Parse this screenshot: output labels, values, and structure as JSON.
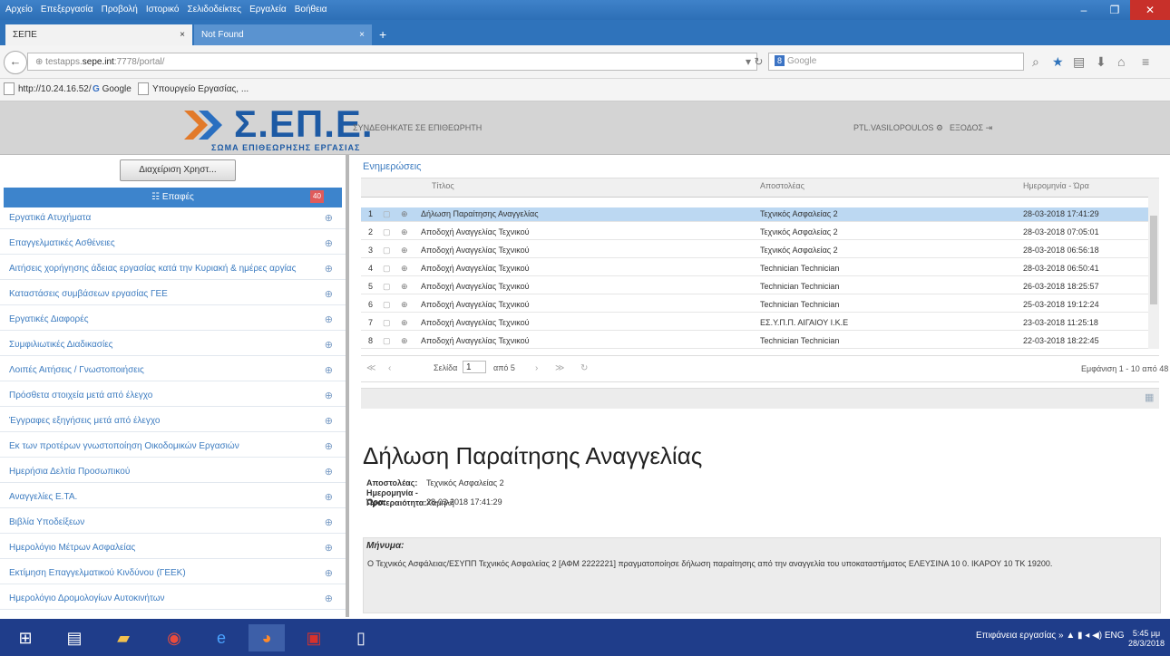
{
  "browser": {
    "menu": [
      "Αρχείο",
      "Επεξεργασία",
      "Προβολή",
      "Ιστορικό",
      "Σελιδοδείκτες",
      "Εργαλεία",
      "Βοήθεια"
    ],
    "window_controls": [
      "–",
      "❐",
      "✕"
    ],
    "tabs": [
      {
        "title": "ΣΕΠΕ",
        "close": "×"
      },
      {
        "title": "Not Found",
        "close": "×"
      }
    ],
    "new_tab": "+",
    "url_prefix": "testapps.",
    "url_host": "sepe.int",
    "url_rest": ":7778/portal/",
    "search_engine": "8",
    "search_placeholder": "Google",
    "bookmarks": [
      "http://10.24.16.52/",
      "Google",
      "Υπουργείο Εργασίας, ..."
    ]
  },
  "app": {
    "logo": "Σ.ΕΠ.Ε.",
    "logo_sub": "ΣΩΜΑ ΕΠΙΘΕΩΡΗΣΗΣ ΕΡΓΑΣΙΑΣ",
    "header_title": "ΣΥΝΔΕΘΗΚΑΤΕ ΣΕ ΕΠΙΘΕΩΡΗΤΗ",
    "user": "PTL.VASILOPOULOS",
    "logout": "ΕΞΟΔΟΣ"
  },
  "sidebar": {
    "select_button": "Διαχείριση Χρηστ...",
    "header": "Επαφές",
    "badge": "40",
    "items": [
      "Εργατικά Ατυχήματα",
      "Επαγγελματικές Ασθένειες",
      "Αιτήσεις χορήγησης άδειας εργασίας κατά την Κυριακή & ημέρες αργίας",
      "Καταστάσεις συμβάσεων εργασίας ΓΕΕ",
      "Εργατικές Διαφορές",
      "Συμφιλιωτικές Διαδικασίες",
      "Λοιπές Αιτήσεις / Γνωστοποιήσεις",
      "Πρόσθετα στοιχεία μετά από έλεγχο",
      "Έγγραφες εξηγήσεις μετά από έλεγχο",
      "Εκ των προτέρων γνωστοποίηση Οικοδομικών Εργασιών",
      "Ημερήσια Δελτία Προσωπικού",
      "Αναγγελίες Ε.ΤΑ.",
      "Βιβλία Υποδείξεων",
      "Ημερολόγιο Μέτρων Ασφαλείας",
      "Εκτίμηση Επαγγελματικού Κινδύνου (ΓΕΕΚ)",
      "Ημερολόγιο Δρομολογίων Αυτοκινήτων"
    ]
  },
  "main": {
    "title": "Ενημερώσεις",
    "columns": [
      "Τίτλος",
      "Αποστολέας",
      "Ημερομηνία - Ώρα"
    ],
    "rows": [
      {
        "num": "1",
        "title": "Δήλωση Παραίτησης Αναγγελίας",
        "sender": "Τεχνικός Ασφαλείας 2",
        "date": "28-03-2018 17:41:29"
      },
      {
        "num": "2",
        "title": "Αποδοχή Αναγγελίας Τεχνικού",
        "sender": "Τεχνικός Ασφαλείας 2",
        "date": "28-03-2018 07:05:01"
      },
      {
        "num": "3",
        "title": "Αποδοχή Αναγγελίας Τεχνικού",
        "sender": "Τεχνικός Ασφαλείας 2",
        "date": "28-03-2018 06:56:18"
      },
      {
        "num": "4",
        "title": "Αποδοχή Αναγγελίας Τεχνικού",
        "sender": "Technician Technician",
        "date": "28-03-2018 06:50:41"
      },
      {
        "num": "5",
        "title": "Αποδοχή Αναγγελίας Τεχνικού",
        "sender": "Technician Technician",
        "date": "26-03-2018 18:25:57"
      },
      {
        "num": "6",
        "title": "Αποδοχή Αναγγελίας Τεχνικού",
        "sender": "Technician Technician",
        "date": "25-03-2018 19:12:24"
      },
      {
        "num": "7",
        "title": "Αποδοχή Αναγγελίας Τεχνικού",
        "sender": "ΕΣ.Υ.Π.Π. ΑΙΓΑΙΟΥ Ι.Κ.Ε",
        "date": "23-03-2018 11:25:18"
      },
      {
        "num": "8",
        "title": "Αποδοχή Αναγγελίας Τεχνικού",
        "sender": "Technician Technician",
        "date": "22-03-2018 18:22:45"
      }
    ],
    "pager": {
      "first": "≪",
      "prev": "‹",
      "page_label": "Σελίδα",
      "page": "1",
      "of": "από 5",
      "next": "›",
      "last": "≫",
      "refresh": "↻",
      "info": "Εμφάνιση 1 - 10 από 48"
    }
  },
  "detail": {
    "title": "Δήλωση Παραίτησης Αναγγελίας",
    "sender_label": "Αποστολέας:",
    "sender": "Τεχνικός Ασφαλείας 2",
    "date_label": "Ημερομηνία - Ώρα:",
    "date": "28-03-2018 17:41:29",
    "priority_label": "Προτεραιότητα:",
    "priority": "Χαμηλή",
    "message_label": "Μήνυμα:",
    "message": "Ο Τεχνικός Ασφάλειας/ΕΣΥΠΠ Τεχνικός Ασφαλείας 2 [ΑΦΜ 2222221] πραγματοποίησε δήλωση παραίτησης από την αναγγελία του υποκαταστήματος ΕΛΕΥΣΙΝΑ 10 0. ΙΚΑΡΟΥ 10 ΤΚ 19200."
  },
  "taskbar": {
    "tray_text": "Επιφάνεια εργασίας",
    "lang": "ENG",
    "time": "5:45 μμ",
    "date": "28/3/2018"
  },
  "colors": {
    "accent": "#3d84cc",
    "titlebar": "#2d6fb6",
    "taskbar": "#1f3d8a",
    "selected_row": "#bcd8f2",
    "badge": "#e05b5b"
  }
}
